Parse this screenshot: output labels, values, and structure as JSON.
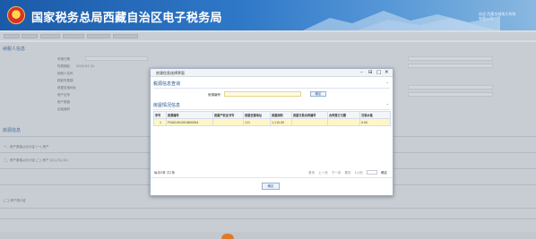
{
  "header": {
    "title": "国家税务总局西藏自治区电子税务局",
    "user_line1": "欢迎 西藏龙城地大系统",
    "user_line2": "有限公司"
  },
  "background": {
    "section1_title": "纳税人信息",
    "section2_title": "房源信息",
    "row_labels": [
      "申报日期",
      "所属期起",
      "纳税人名称",
      "税款所属期",
      "房屋坐落地址",
      "房产证号",
      "房产原值",
      "出租面积"
    ],
    "value_2019": "2019-07-31",
    "sub_items": [
      "一、房产原值从价计征 (一) 房产",
      "二、房产原值从价计征 (二) 房产 ((2)-(3)-(4))",
      "(二) 房产税计征"
    ]
  },
  "modal": {
    "title": "房源信息选择界面",
    "controls": {
      "minimize": "–",
      "restore": "⊟",
      "maximize": "□",
      "close": "✕"
    },
    "query_panel_title": "税源信息查询",
    "query_label": "房源编号",
    "query_value": "",
    "query_button": "确定",
    "house_panel_title": "房屋情况信息",
    "table": {
      "headers": [
        "序号",
        "房源编号",
        "房屋产权证书号",
        "房屋坐落地址",
        "房屋面积",
        "房屋交易合同编号",
        "合同签订日期",
        "交易价格"
      ],
      "rows": [
        [
          "1",
          "F5401001001800004",
          "",
          "111",
          "1,110.00",
          "",
          "",
          "0.00"
        ]
      ]
    },
    "pager": {
      "page_size": "每页5条 共1条",
      "first": "首页",
      "prev": "上一页",
      "next": "下一页",
      "last": "尾页",
      "page_info": "1/1页",
      "go": "确定"
    },
    "ok_button": "确定"
  }
}
